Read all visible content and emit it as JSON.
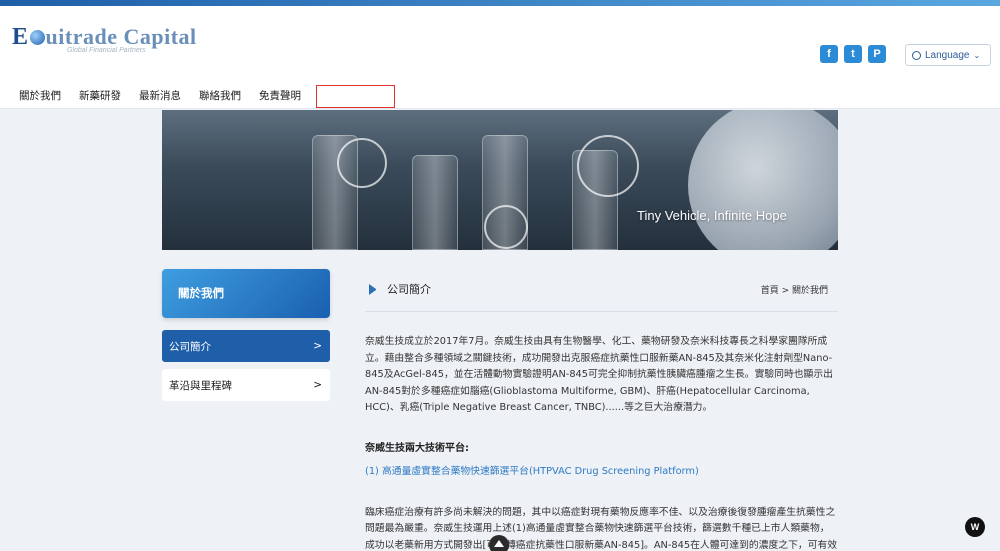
{
  "brand": {
    "logo_first": "E",
    "logo_rest": "uitrade Capital",
    "tagline": "Global Financial Partners"
  },
  "social": [
    "f",
    "t",
    "P"
  ],
  "language_label": "Language",
  "nav": [
    "關於我們",
    "新藥研發",
    "最新消息",
    "聯絡我們",
    "免責聲明"
  ],
  "hero": {
    "tagline": "Tiny Vehicle, Infinite Hope"
  },
  "sidebar": {
    "title": "關於我們",
    "items": [
      {
        "label": "公司簡介",
        "chevron": ">"
      },
      {
        "label": "革沿與里程碑",
        "chevron": ">"
      }
    ]
  },
  "content": {
    "section_title": "公司簡介",
    "breadcrumb": "首頁 > 關於我們",
    "intro": "奈威生技成立於2017年7月。奈威生技由具有生物醫學、化工、藥物研發及奈米科技專長之科學家團隊所成立。藉由整合多種領域之關鍵技術，成功開發出克服癌症抗藥性口服新藥AN-845及其奈米化注射劑型Nano-845及AcGel-845，並在活體動物實驗證明AN-845可完全抑制抗藥性胰臟癌腫瘤之生長。實驗同時也顯示出AN-845對於多種癌症如腦癌(Glioblastoma Multiforme, GBM)、肝癌(Hepatocellular Carcinoma, HCC)、乳癌(Triple Negative Breast Cancer, TNBC)......等之巨大治療潛力。",
    "platform_heading": "奈威生技兩大技術平台:",
    "platform_link": "(1) 高通量虛實整合藥物快速篩選平台(HTPVAC Drug Screening Platform)",
    "para2": "臨床癌症治療有許多尚未解決的問題，其中以癌症對現有藥物反應率不佳、以及治療後復發腫瘤產生抗藥性之問題最為嚴重。奈威生技運用上述(1)高通量虛實整合藥物快速篩選平台技術，篩選數千種已上市人類藥物，成功以老藥新用方式開發出[可逆轉癌症抗藥性口服新藥AN-845]。AN-845在人體可達到的濃度之下，可有效抑制包括胰臟癌(Pancreatic Cancer)、腦癌(Glioblastoma multiforme, GBM)、肝癌(Hepatocellular Carcinoma"
  },
  "widget_badge": "W"
}
